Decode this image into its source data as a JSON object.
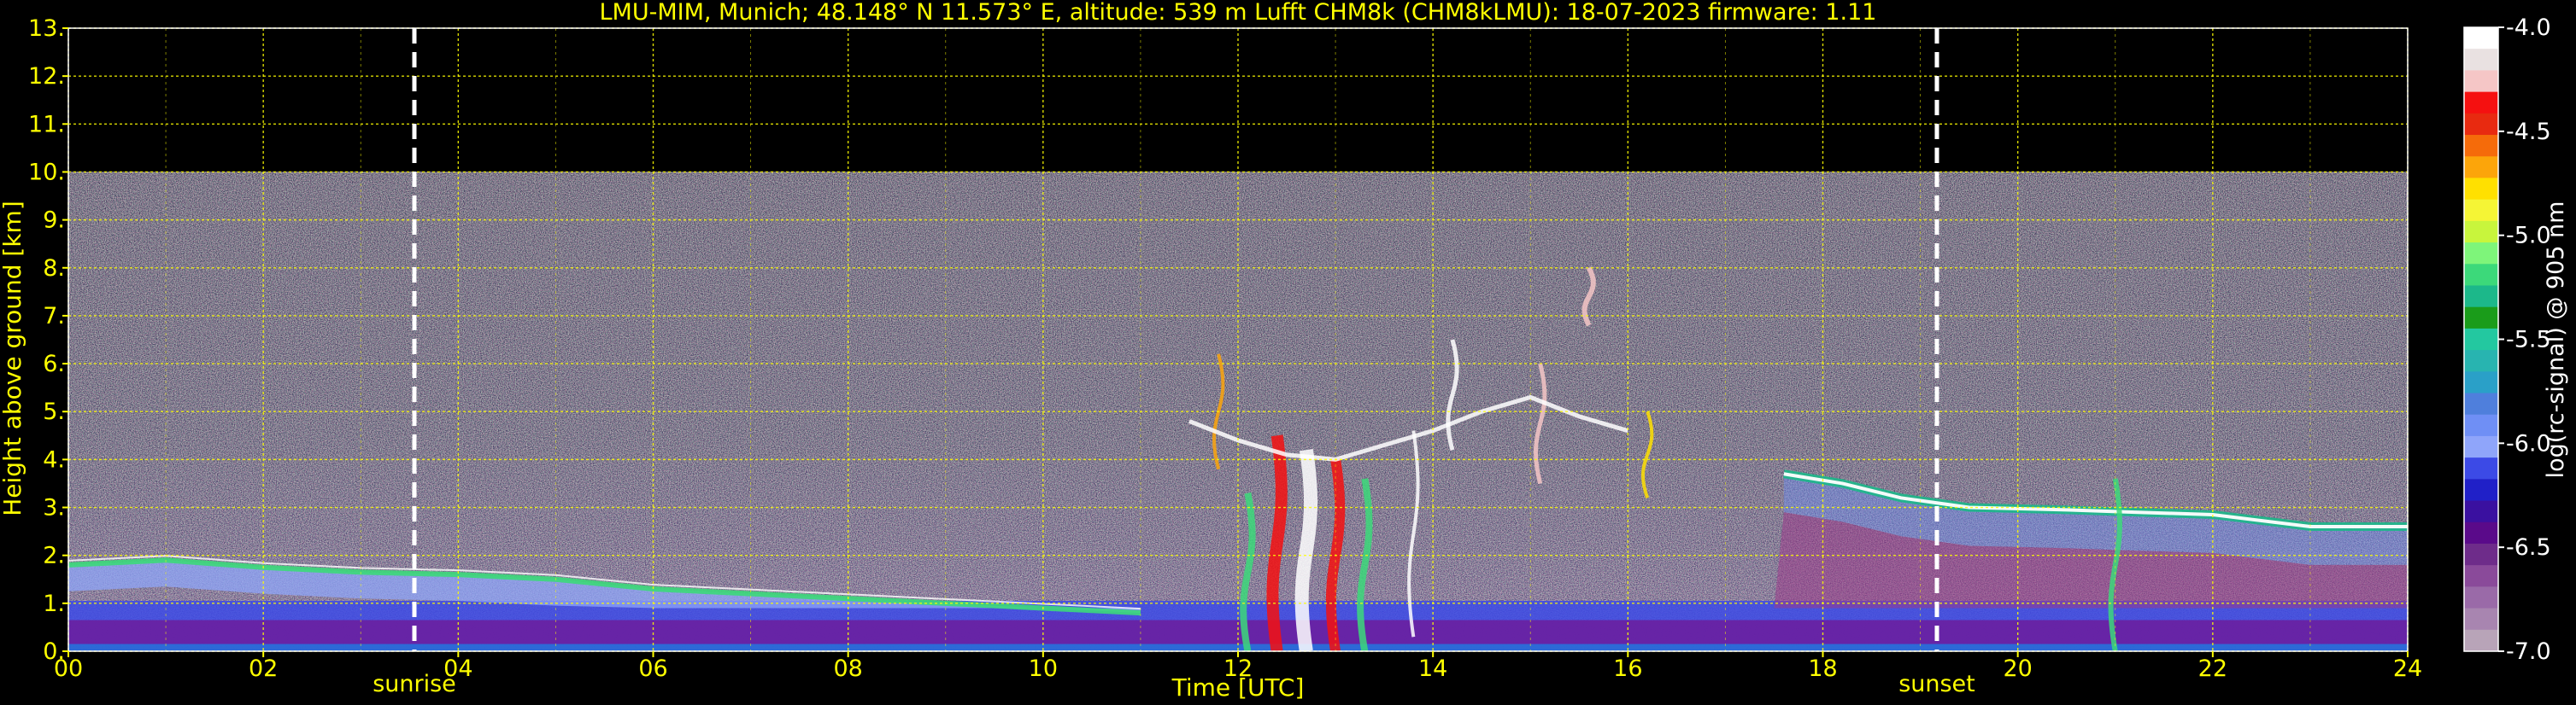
{
  "chart_data": {
    "type": "heatmap",
    "title": "LMU-MIM, Munich; 48.148° N 11.573° E, altitude: 539 m    Lufft CHM8k (CHM8kLMU): 18-07-2023    firmware: 1.11",
    "xlabel": "Time [UTC]",
    "ylabel": "Height above ground [km]",
    "xlim": [
      0,
      24
    ],
    "ylim": [
      0,
      13
    ],
    "x_ticks": [
      "00",
      "02",
      "04",
      "06",
      "08",
      "10",
      "12",
      "14",
      "16",
      "18",
      "20",
      "22",
      "24"
    ],
    "y_ticks": [
      "0.",
      "1.",
      "2.",
      "3.",
      "4.",
      "5.",
      "6.",
      "7.",
      "8.",
      "9.",
      "10.",
      "11.",
      "12.",
      "13."
    ],
    "grid": true,
    "data_top_km": 10,
    "events": [
      {
        "label": "sunrise",
        "x": 3.55
      },
      {
        "label": "sunset",
        "x": 19.17
      }
    ],
    "colorbar": {
      "label": "log(rc-signal) @ 905 nm",
      "range": [
        -7.0,
        -4.0
      ],
      "ticks": [
        "-4.0",
        "-4.5",
        "-5.0",
        "-5.5",
        "-6.0",
        "-6.5",
        "-7.0"
      ],
      "colors": [
        "#ffffff",
        "#e9e1e1",
        "#f5c6c6",
        "#f51010",
        "#e82a10",
        "#f56b0a",
        "#fca50a",
        "#ffe000",
        "#f5f535",
        "#c8f53c",
        "#7ef57a",
        "#3cd97a",
        "#1cb88a",
        "#1a9c1a",
        "#23c8a0",
        "#28b4b0",
        "#2aa0c8",
        "#4f7fdc",
        "#6f8ff5",
        "#8fa5fa",
        "#3c4ae6",
        "#2020c8",
        "#3a10a0",
        "#5a0a8a",
        "#6e2c8a",
        "#8a4a9a",
        "#9a6aa8",
        "#a885b0",
        "#b8a4b8"
      ],
      "colors_top_to_bottom": true
    },
    "features": [
      {
        "name": "aerosol layer",
        "x_start": 0,
        "x_end": 24,
        "y_low": 0.15,
        "y_high": 0.9
      },
      {
        "name": "boundary layer top",
        "points": [
          [
            0,
            1.8
          ],
          [
            1,
            1.9
          ],
          [
            2,
            1.75
          ],
          [
            3,
            1.65
          ],
          [
            4,
            1.6
          ],
          [
            5,
            1.5
          ],
          [
            6,
            1.3
          ],
          [
            7,
            1.2
          ],
          [
            8,
            1.1
          ],
          [
            9,
            1.0
          ],
          [
            10,
            0.9
          ],
          [
            11,
            0.8
          ]
        ]
      },
      {
        "name": "evening cloud layer",
        "points": [
          [
            17.6,
            3.7
          ],
          [
            18.2,
            3.5
          ],
          [
            18.8,
            3.2
          ],
          [
            19.5,
            3.0
          ],
          [
            20.5,
            2.95
          ],
          [
            21.2,
            2.9
          ],
          [
            22,
            2.85
          ],
          [
            23,
            2.6
          ],
          [
            24,
            2.6
          ]
        ]
      },
      {
        "name": "convective clouds",
        "x_start": 11.3,
        "x_end": 16.6,
        "y_low": 0,
        "y_high": 8.5
      }
    ]
  }
}
